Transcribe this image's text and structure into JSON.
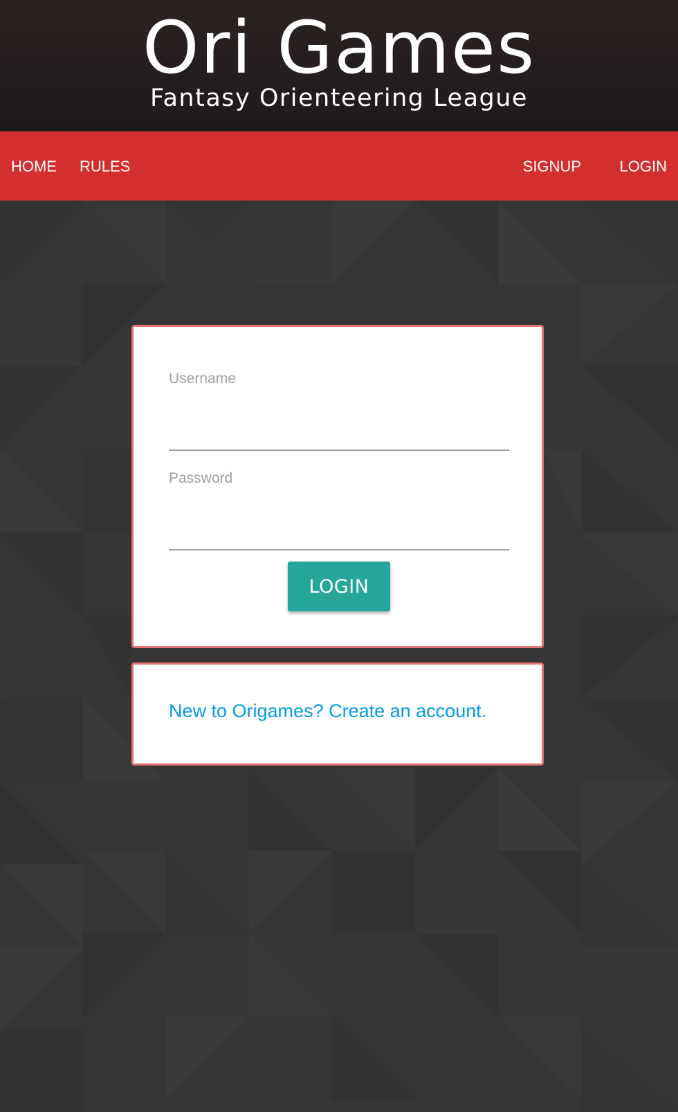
{
  "header": {
    "title": "Ori Games",
    "subtitle": "Fantasy Orienteering League"
  },
  "nav": {
    "left": [
      {
        "label": "HOME"
      },
      {
        "label": "RULES"
      }
    ],
    "right": [
      {
        "label": "SIGNUP"
      },
      {
        "label": "LOGIN"
      }
    ]
  },
  "login_form": {
    "username_label": "Username",
    "username_value": "",
    "password_label": "Password",
    "password_value": "",
    "submit_label": "LOGIN"
  },
  "signup_prompt": {
    "link_text": "New to Origames? Create an account."
  },
  "colors": {
    "header_bg": "#231c1c",
    "nav_bg": "#d32f2f",
    "page_bg": "#353535",
    "card_border": "#e57373",
    "button_bg": "#26a69a",
    "link": "#039be5"
  }
}
